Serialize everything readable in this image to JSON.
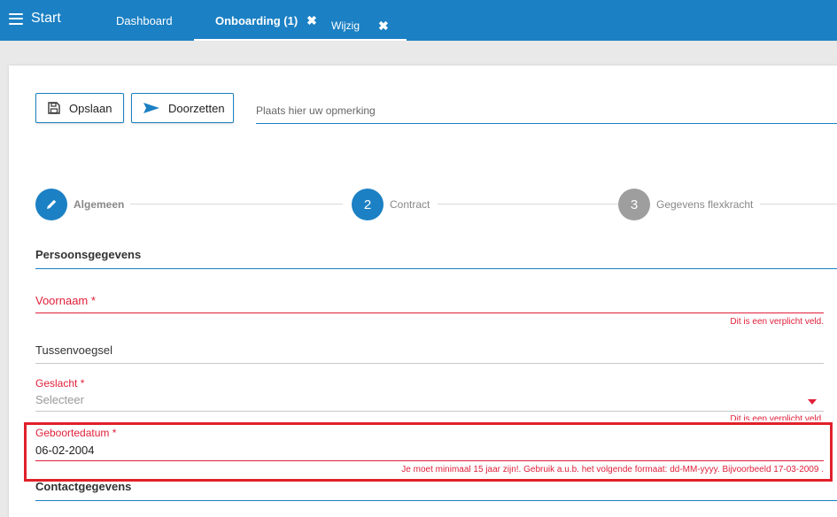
{
  "topbar": {
    "start_label": "Start",
    "tabs": [
      {
        "label": "Dashboard"
      },
      {
        "label": "Onboarding (1)",
        "close": "✖"
      },
      {
        "label": "Wijzig",
        "close": "✖"
      }
    ]
  },
  "toolbar": {
    "save_label": "Opslaan",
    "forward_label": "Doorzetten",
    "remark_placeholder": "Plaats hier uw opmerking"
  },
  "stepper": {
    "steps": [
      {
        "label": "Algemeen",
        "icon": "pencil-icon",
        "state": "done"
      },
      {
        "number": "2",
        "label": "Contract",
        "state": "active"
      },
      {
        "number": "3",
        "label": "Gegevens flexkracht",
        "state": "pending"
      }
    ]
  },
  "sections": {
    "personal": "Persoonsgegevens",
    "contact": "Contactgegevens"
  },
  "fields": {
    "voornaam": {
      "label": "Voornaam",
      "required_mark": "*",
      "value": "",
      "error": "Dit is een verplicht veld."
    },
    "tussenvoegsel": {
      "label": "Tussenvoegsel",
      "value": ""
    },
    "geslacht": {
      "label": "Geslacht",
      "required_mark": "*",
      "placeholder": "Selecteer",
      "error": "Dit is een verplicht veld."
    },
    "geboortedatum": {
      "label": "Geboortedatum",
      "required_mark": "*",
      "value": "06-02-2004",
      "error": "Je moet minimaal 15 jaar zijn!. Gebruik a.u.b. het volgende formaat: dd-MM-yyyy. Bijvoorbeeld 17-03-2009 ."
    }
  },
  "colors": {
    "primary": "#1b80c4",
    "error": "#e0203a",
    "highlight": "#e0202a",
    "step_pending": "#9e9e9e"
  }
}
